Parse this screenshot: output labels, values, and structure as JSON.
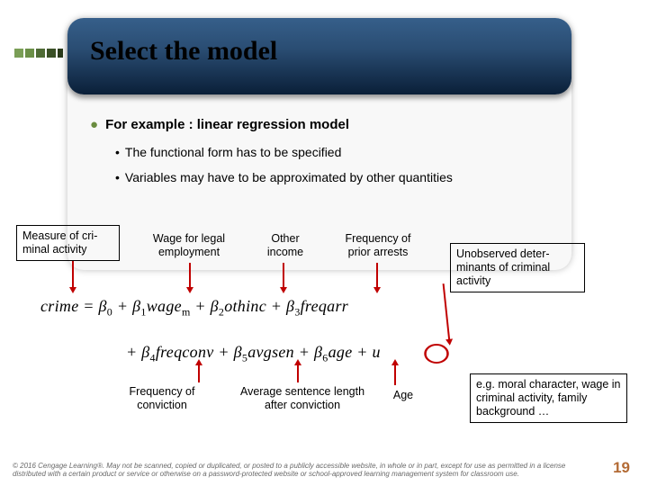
{
  "title": "Select the model",
  "bullet_main": "For example : linear regression model",
  "bullet_sub_1": "The functional form has to be specified",
  "bullet_sub_2": "Variables may have to be approximated by other quantities",
  "annotations": {
    "measure": "Measure of cri­minal activity",
    "wage": "Wage for legal employment",
    "other_income": "Other income",
    "freq_arrests": "Frequency of prior arrests",
    "unobserved": "Unobserved deter­minants of criminal activity",
    "freq_conv": "Frequency of conviction",
    "avg_sen": "Average sentence length after conviction",
    "age": "Age",
    "examples": "e.g. moral character, wage in criminal activity, family background …"
  },
  "equation": {
    "lhs": "crime",
    "eq": " = ",
    "b0": "β",
    "plus": " + ",
    "terms": {
      "t1": "wage",
      "t1s": "m",
      "t2": "othinc",
      "t3": "freqarr",
      "t4": "freqconv",
      "t5": "avgsen",
      "t6": "age",
      "u": "u"
    }
  },
  "copyright": "© 2016 Cengage Learning®. May not be scanned, copied or duplicated, or posted to a publicly accessible website, in whole or in part, except for use as permitted in a license distributed with a certain product or service or otherwise on a password-protected website or school-approved learning management system for classroom use.",
  "page_number": "19"
}
